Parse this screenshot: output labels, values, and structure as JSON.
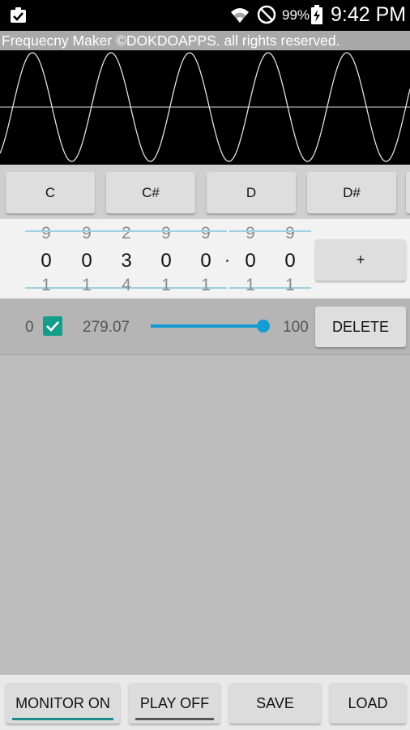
{
  "status_bar": {
    "battery_percent": "99%",
    "time": "9:42 PM"
  },
  "app": {
    "title": "Frequecny Maker ©DOKDOAPPS. all rights reserved."
  },
  "notes": [
    "C",
    "C#",
    "D",
    "D#"
  ],
  "picker": {
    "columns": [
      {
        "above": "9",
        "value": "0",
        "below": "1"
      },
      {
        "above": "9",
        "value": "0",
        "below": "1"
      },
      {
        "above": "2",
        "value": "3",
        "below": "4"
      },
      {
        "above": "9",
        "value": "0",
        "below": "1"
      },
      {
        "above": "9",
        "value": "0",
        "below": "1"
      },
      {
        "above": "9",
        "value": "0",
        "below": "1"
      },
      {
        "above": "9",
        "value": "0",
        "below": "1"
      }
    ],
    "add_label": "+"
  },
  "tones": [
    {
      "index": "0",
      "checked": true,
      "frequency": "279.07",
      "volume": "100",
      "volume_fraction": 1.0,
      "delete_label": "DELETE"
    }
  ],
  "bottom": {
    "monitor": "MONITOR ON",
    "play": "PLAY OFF",
    "save": "SAVE",
    "load": "LOAD"
  },
  "colors": {
    "accent_teal": "#139e8c",
    "slider_blue": "#139dd4",
    "monitor_on_indicator": "#1a8c8a",
    "play_off_indicator": "#555555"
  }
}
